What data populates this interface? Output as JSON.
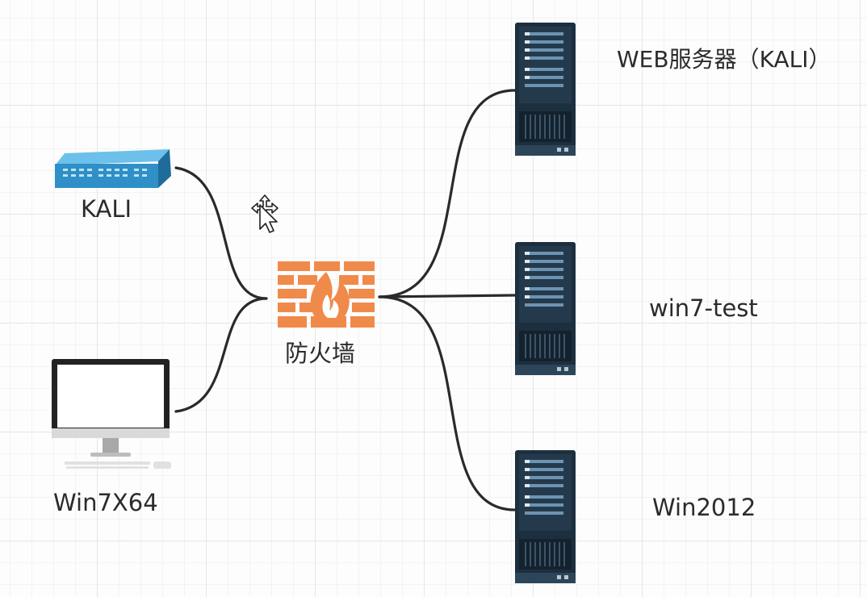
{
  "nodes": {
    "kali_switch": {
      "label": "KALI",
      "icon": "network-switch-icon"
    },
    "win7x64": {
      "label": "Win7X64",
      "icon": "desktop-monitor-icon"
    },
    "firewall": {
      "label": "防火墙",
      "icon": "firewall-icon"
    },
    "web_server": {
      "label": "WEB服务器（KALI）",
      "icon": "server-rack-icon"
    },
    "win7_test": {
      "label": "win7-test",
      "icon": "server-rack-icon"
    },
    "win2012": {
      "label": "Win2012",
      "icon": "server-rack-icon"
    }
  },
  "colors": {
    "switch": "#2f8fc7",
    "firewall": "#f08a4b",
    "server": "#243a4c",
    "connector": "#2a2a2a"
  }
}
